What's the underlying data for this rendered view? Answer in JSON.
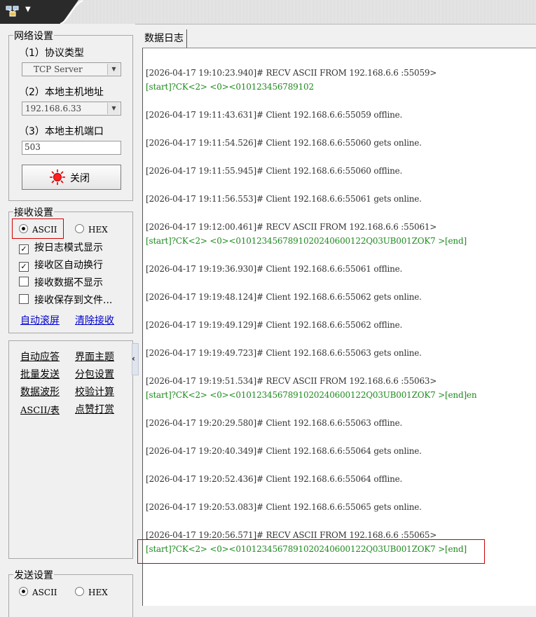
{
  "colors": {
    "accent_red": "#d00000",
    "link_blue": "#0000cc",
    "data_green": "#1f8a1f"
  },
  "titlebar": {
    "app_icon": "network-app-icon",
    "dropdown_icon": "chevron-down-icon"
  },
  "net_settings": {
    "title": "网络设置",
    "protocol_label": "（1）协议类型",
    "protocol_value": "TCP Server",
    "host_label": "（2）本地主机地址",
    "host_value": "192.168.6.33",
    "port_label": "（3）本地主机端口",
    "port_value": "503",
    "close_button": "关闭",
    "close_icon": "red-indicator-icon"
  },
  "recv_settings": {
    "title": "接收设置",
    "ascii_label": "ASCII",
    "hex_label": "HEX",
    "opt_log_mode": "按日志模式显示",
    "opt_auto_wrap": "接收区自动换行",
    "opt_hide_data": "接收数据不显示",
    "opt_save_file": "接收保存到文件...",
    "auto_scroll": "自动滚屏",
    "clear_recv": "清除接收"
  },
  "tools": {
    "auto_reply": "自动应答",
    "theme": "界面主题",
    "batch_send": "批量发送",
    "split_packet": "分包设置",
    "waveform": "数据波形",
    "checksum": "校验计算",
    "ascii_table": "ASCII/表",
    "dot_matrix": "点赞打赏"
  },
  "send_settings": {
    "title": "发送设置",
    "ascii_label": "ASCII",
    "hex_label": "HEX"
  },
  "splitter": {
    "icon": "chevron-left-icon"
  },
  "log_tab": {
    "label": "数据日志"
  },
  "log": [
    {
      "text": "[2026-04-17 19:10:23.940]# RECV ASCII FROM 192.168.6.6 :55059>",
      "kind": "header"
    },
    {
      "text": "[start]?CK<2> <0><010123456789102",
      "kind": "data"
    },
    {
      "text": "[2026-04-17 19:11:43.631]# Client 192.168.6.6:55059 offline.",
      "kind": "header"
    },
    {
      "text": "[2026-04-17 19:11:54.526]# Client 192.168.6.6:55060 gets online.",
      "kind": "header"
    },
    {
      "text": "[2026-04-17 19:11:55.945]# Client 192.168.6.6:55060 offline.",
      "kind": "header"
    },
    {
      "text": "[2026-04-17 19:11:56.553]# Client 192.168.6.6:55061 gets online.",
      "kind": "header"
    },
    {
      "text": "[2026-04-17 19:12:00.461]# RECV ASCII FROM 192.168.6.6 :55061>",
      "kind": "header"
    },
    {
      "text": "[start]?CK<2> <0><0101234567891020240600122Q03UB001ZOK7     >[end]",
      "kind": "data"
    },
    {
      "text": "[2026-04-17 19:19:36.930]# Client 192.168.6.6:55061 offline.",
      "kind": "header"
    },
    {
      "text": "[2026-04-17 19:19:48.124]# Client 192.168.6.6:55062 gets online.",
      "kind": "header"
    },
    {
      "text": "[2026-04-17 19:19:49.129]# Client 192.168.6.6:55062 offline.",
      "kind": "header"
    },
    {
      "text": "[2026-04-17 19:19:49.723]# Client 192.168.6.6:55063 gets online.",
      "kind": "header"
    },
    {
      "text": "[2026-04-17 19:19:51.534]# RECV ASCII FROM 192.168.6.6 :55063>",
      "kind": "header"
    },
    {
      "text": "[start]?CK<2> <0><0101234567891020240600122Q03UB001ZOK7 >[end]en",
      "kind": "data"
    },
    {
      "text": "[2026-04-17 19:20:29.580]# Client 192.168.6.6:55063 offline.",
      "kind": "header"
    },
    {
      "text": "[2026-04-17 19:20:40.349]# Client 192.168.6.6:55064 gets online.",
      "kind": "header"
    },
    {
      "text": "[2026-04-17 19:20:52.436]# Client 192.168.6.6:55064 offline.",
      "kind": "header"
    },
    {
      "text": "[2026-04-17 19:20:53.083]# Client 192.168.6.6:55065 gets online.",
      "kind": "header"
    },
    {
      "text": "[2026-04-17 19:20:56.571]# RECV ASCII FROM 192.168.6.6 :55065>",
      "kind": "header"
    },
    {
      "text": "[start]?CK<2> <0><0101234567891020240600122Q03UB001ZOK7 >[end]",
      "kind": "data"
    }
  ]
}
